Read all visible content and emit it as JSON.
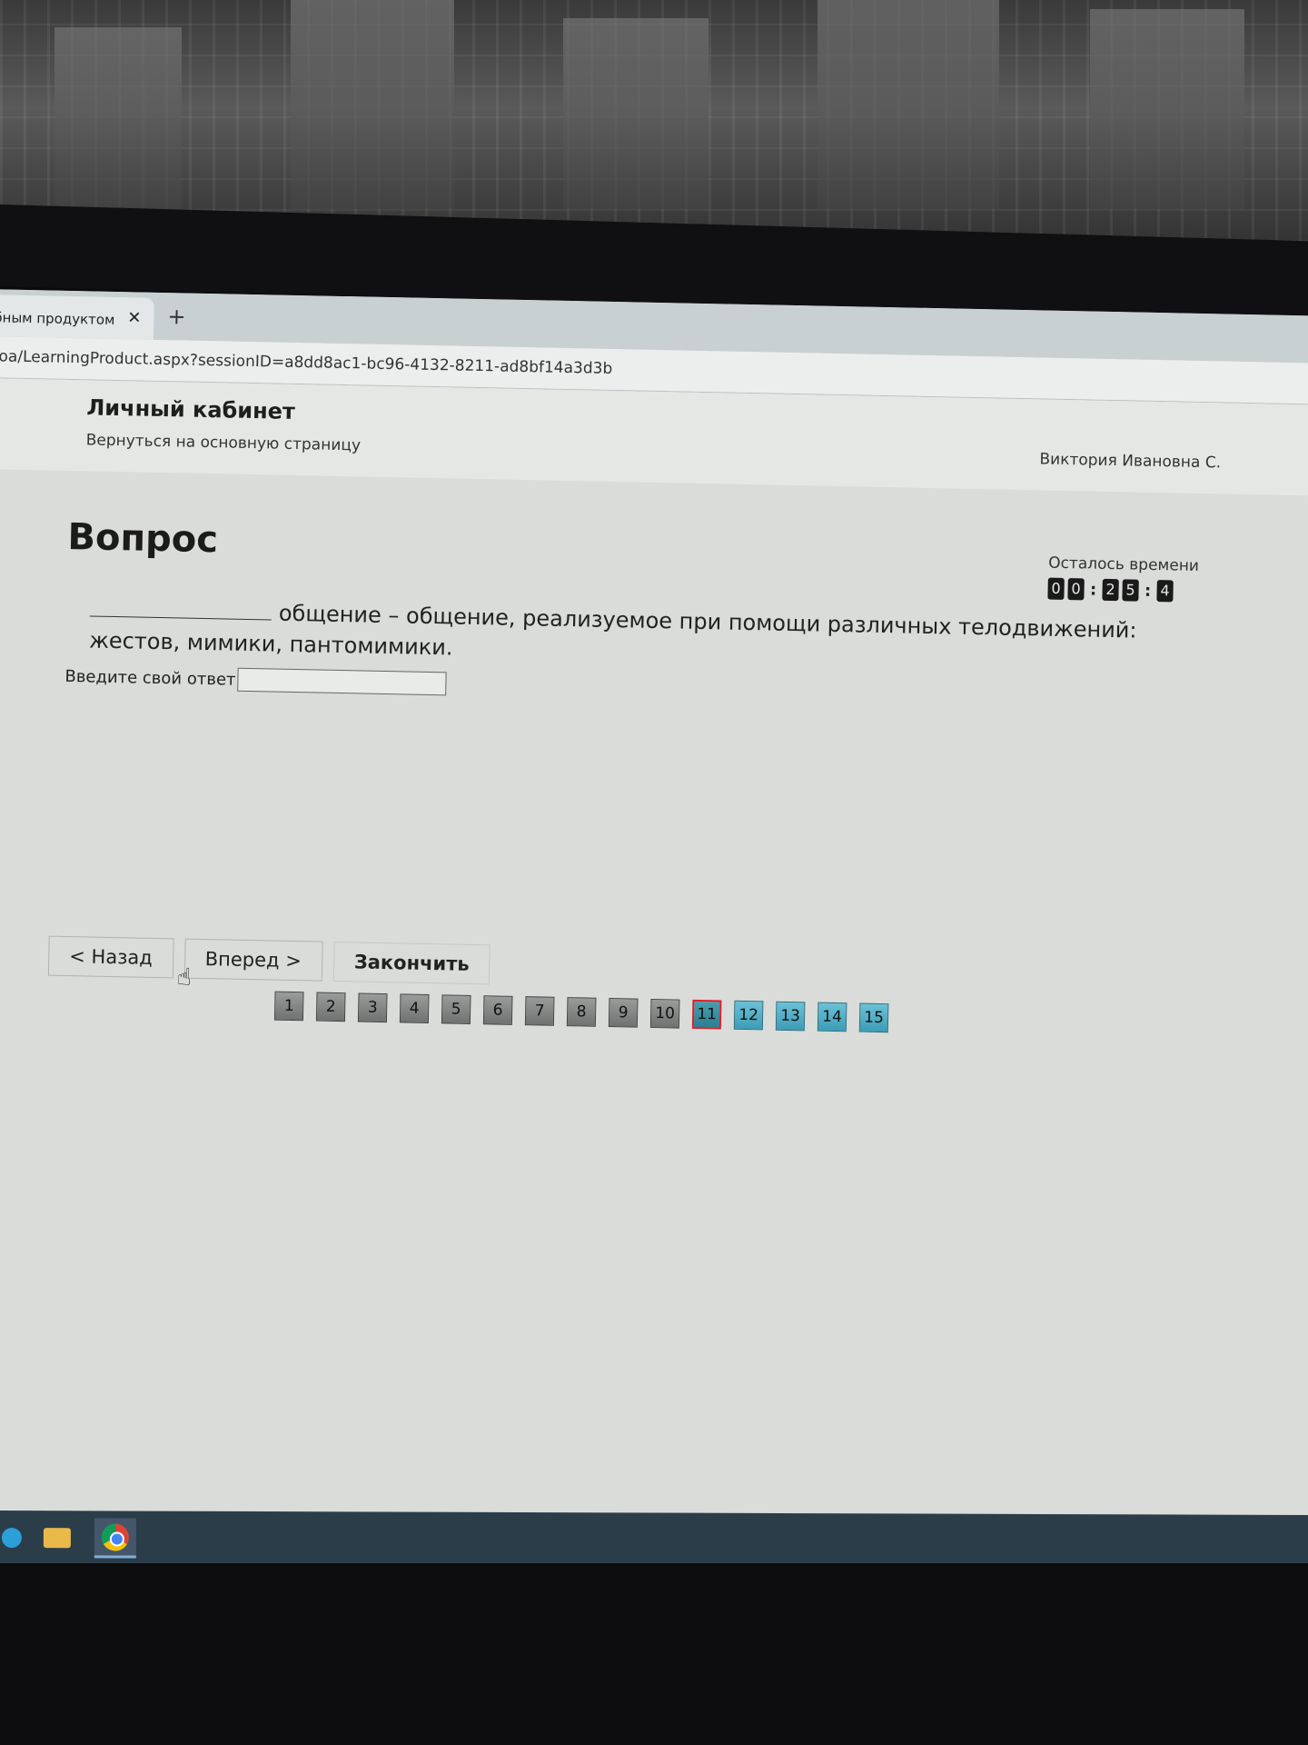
{
  "browser": {
    "tab_label": "бным продуктом",
    "close_symbol": "✕",
    "new_tab_symbol": "+",
    "address": "oa/LearningProduct.aspx?sessionID=a8dd8ac1-bc96-4132-8211-ad8bf14a3d3b"
  },
  "header": {
    "title": "Личный кабинет",
    "back_link": "Вернуться на основную страницу",
    "user_name": "Виктория Ивановна С."
  },
  "question": {
    "heading": "Вопрос",
    "text": "общение – общение, реализуемое при помощи различных телодвижений: жестов, мимики, пантомимики.",
    "answer_label": "Введите свой ответ",
    "answer_value": ""
  },
  "timer": {
    "label": "Осталось времени",
    "digits": [
      "0",
      "0",
      "2",
      "5",
      "4"
    ]
  },
  "navigation": {
    "back_label": "< Назад",
    "forward_label": "Вперед >",
    "finish_label": "Закончить"
  },
  "pagination": {
    "pages": [
      "1",
      "2",
      "3",
      "4",
      "5",
      "6",
      "7",
      "8",
      "9",
      "10",
      "11",
      "12",
      "13",
      "14",
      "15"
    ],
    "current": "11",
    "colors": {
      "answered": "#7f8280",
      "current_border": "#e01c2c",
      "unanswered": "#4aaec6"
    }
  },
  "taskbar": {
    "icons": [
      "edge-icon",
      "file-explorer-icon",
      "chrome-icon"
    ]
  }
}
